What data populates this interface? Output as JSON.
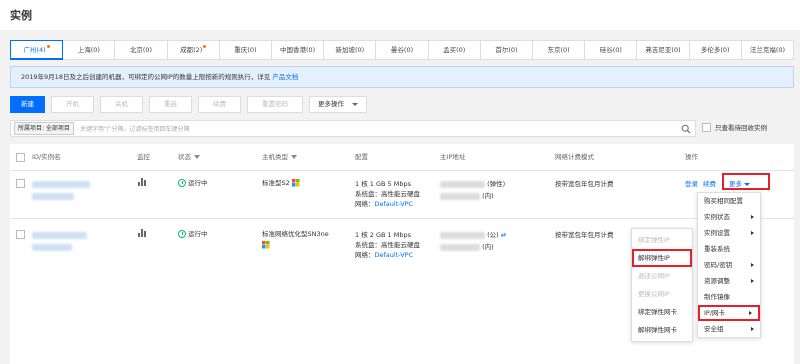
{
  "page_title": "实例",
  "regions": [
    {
      "label": "广州(4)",
      "active": true,
      "dot": true
    },
    {
      "label": "上海(0)"
    },
    {
      "label": "北京(0)"
    },
    {
      "label": "成都(2)",
      "dot": true
    },
    {
      "label": "重庆(0)"
    },
    {
      "label": "中国香港(0)"
    },
    {
      "label": "新加坡(0)"
    },
    {
      "label": "曼谷(0)"
    },
    {
      "label": "孟买(0)"
    },
    {
      "label": "首尔(0)"
    },
    {
      "label": "东京(0)"
    },
    {
      "label": "硅谷(0)"
    },
    {
      "label": "弗吉尼亚(0)"
    },
    {
      "label": "多伦多(0)"
    },
    {
      "label": "法兰克福(0)"
    }
  ],
  "notice": {
    "text": "2019年9月18日及之后创建的机器，可绑定的公网IP的数量上限按新的规则执行，详见",
    "link": "产品文档"
  },
  "toolbar": {
    "new": "新建",
    "start": "开机",
    "stop": "关机",
    "restart": "重启",
    "renew": "续费",
    "reset_password": "重置密码",
    "more_actions": "更多操作"
  },
  "search": {
    "tag": "所属项目: 全部项目",
    "placeholder": "关键字用\"|\"分隔，过滤标签用回车键分隔"
  },
  "recycle_label": "只查看待回收实例",
  "table": {
    "headers": {
      "id": "ID/实例名",
      "monitor": "监控",
      "status": "状态",
      "type": "主机类型",
      "config": "配置",
      "ip": "主IP地址",
      "billing": "网络计费模式",
      "actions": "操作"
    },
    "rows": [
      {
        "status": "运行中",
        "type": "标准型S2",
        "config_line1": "1 核 1 GB 5 Mbps",
        "config_line2": "系统盘：高性能云硬盘",
        "config_network_label": "网络：",
        "config_network": "Default-VPC",
        "ip_public": "(弹性)",
        "ip_private": "(内)",
        "billing": "按带宽包年包月计费",
        "action_login": "登录",
        "action_renew": "续费",
        "action_more": "更多"
      },
      {
        "status": "运行中",
        "type": "标准网络优化型SN3ne",
        "config_line1": "1 核 2 GB 1 Mbps",
        "config_line2": "系统盘：高性能云硬盘",
        "config_network_label": "网络：",
        "config_network": "Default-VPC",
        "ip_public": "(公)",
        "ip_private": "(内)",
        "billing": "按带宽包年包月计费"
      }
    ]
  },
  "more_menu": [
    {
      "label": "购买相同配置"
    },
    {
      "label": "实例状态",
      "submenu": true
    },
    {
      "label": "实例设置",
      "submenu": true
    },
    {
      "label": "重装系统"
    },
    {
      "label": "密码/密钥",
      "submenu": true
    },
    {
      "label": "资源调整",
      "submenu": true
    },
    {
      "label": "制作镜像"
    },
    {
      "label": "IP/网卡",
      "submenu": true,
      "highlighted": true
    },
    {
      "label": "安全组",
      "submenu": true
    }
  ],
  "ip_submenu": [
    {
      "label": "绑定弹性IP",
      "disabled": true
    },
    {
      "label": "解绑弹性IP",
      "highlighted": true
    },
    {
      "label": "退还公网IP",
      "disabled": true
    },
    {
      "label": "更换公网IP",
      "disabled": true
    },
    {
      "label": "绑定弹性网卡"
    },
    {
      "label": "解绑弹性网卡"
    }
  ],
  "colors": {
    "accent": "#006eff",
    "running": "#0abf5b",
    "highlight": "#e5202a",
    "notice_bg": "#e5f0ff"
  }
}
